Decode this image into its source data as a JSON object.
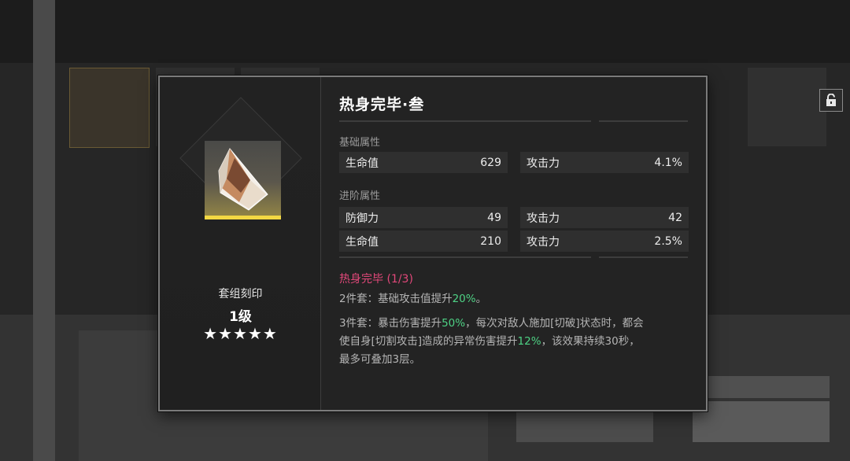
{
  "item": {
    "title": "热身完毕·叁",
    "set_label": "套组刻印",
    "level": "1级",
    "stars": "★★★★★",
    "icon": "crystal-shard-icon",
    "lock_icon": "unlock-icon"
  },
  "base_stats": {
    "label": "基础属性",
    "rows": [
      {
        "name": "生命值",
        "value": "629"
      },
      {
        "name": "攻击力",
        "value": "4.1%"
      }
    ]
  },
  "advanced_stats": {
    "label": "进阶属性",
    "rows": [
      {
        "name": "防御力",
        "value": "49"
      },
      {
        "name": "攻击力",
        "value": "42"
      },
      {
        "name": "生命值",
        "value": "210"
      },
      {
        "name": "攻击力",
        "value": "2.5%"
      }
    ]
  },
  "set_bonus": {
    "name": "热身完毕 (1/3)",
    "two_piece": {
      "prefix": "2件套：基础攻击值提升",
      "value": "20%",
      "suffix": "。"
    },
    "three_piece": {
      "p1": "3件套：暴击伤害提升",
      "v1": "50%",
      "p2": "，每次对敌人施加[切破]状态时，都会",
      "p3": "使自身[切割攻击]造成的异常伤害提升",
      "v2": "12%",
      "p4": "，该效果持续30秒，",
      "p5": "最多可叠加3层。"
    }
  },
  "colors": {
    "accent_yellow": "#f3d843",
    "set_name_pink": "#e2487a",
    "highlight_green": "#4ed184"
  }
}
